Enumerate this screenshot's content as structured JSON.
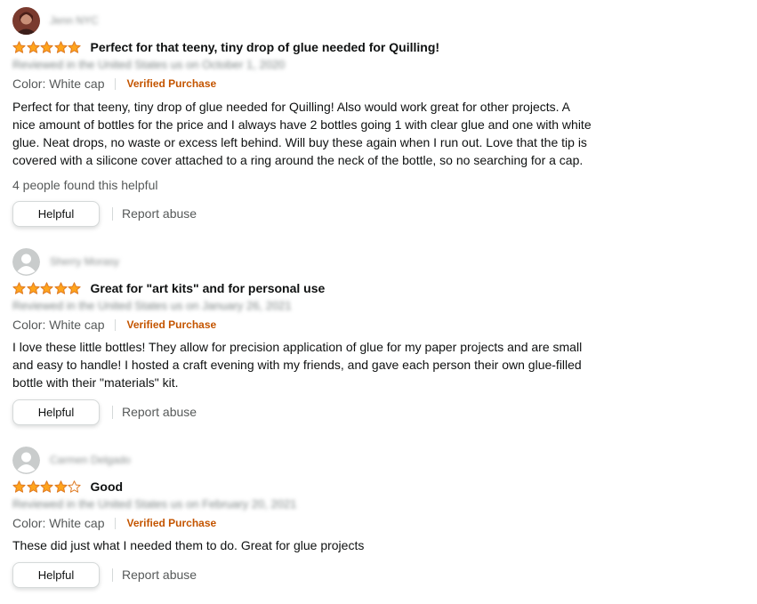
{
  "colors": {
    "star_fill": "#ffa41c",
    "star_stroke": "#de7921",
    "verified": "#c45500",
    "text": "#0f1111",
    "muted": "#565959"
  },
  "reviews": [
    {
      "reviewer_name": "Jenn NYC",
      "avatar": "photo",
      "rating": 5,
      "title": "Perfect for that teeny, tiny drop of glue needed for Quilling!",
      "date_line": "Reviewed in the United States us on October 1, 2020",
      "color_variant": "Color: White cap",
      "verified_label": "Verified Purchase",
      "body_lines": [
        "Perfect for that teeny, tiny drop of glue needed for Quilling! Also would work great for other projects. A",
        "nice amount of bottles for the price and I always have 2 bottles going 1 with clear glue and one with white",
        "glue. Neat drops, no waste or excess left behind. Will buy these again when I run out. Love that the tip is",
        "covered with a silicone cover attached to a ring around the neck of the bottle, so no searching for a cap."
      ],
      "helpful_count_text": "4 people found this helpful",
      "helpful_label": "Helpful",
      "report_label": "Report abuse"
    },
    {
      "reviewer_name": "Sherry Morasy",
      "avatar": "default",
      "rating": 5,
      "title": "Great for \"art kits\" and for personal use",
      "date_line": "Reviewed in the United States us on January 26, 2021",
      "color_variant": "Color: White cap",
      "verified_label": "Verified Purchase",
      "body_lines": [
        "I love these little bottles! They allow for precision application of glue for my paper projects and are small",
        "and easy to handle! I hosted a craft evening with my friends, and gave each person their own glue-filled",
        "bottle with their \"materials\" kit."
      ],
      "helpful_count_text": "",
      "helpful_label": "Helpful",
      "report_label": "Report abuse"
    },
    {
      "reviewer_name": "Carmen Delgado",
      "avatar": "default",
      "rating": 4,
      "title": "Good",
      "date_line": "Reviewed in the United States us on February 20, 2021",
      "color_variant": "Color: White cap",
      "verified_label": "Verified Purchase",
      "body_lines": [
        "These did just what I needed them to do. Great for glue projects"
      ],
      "helpful_count_text": "",
      "helpful_label": "Helpful",
      "report_label": "Report abuse"
    }
  ]
}
